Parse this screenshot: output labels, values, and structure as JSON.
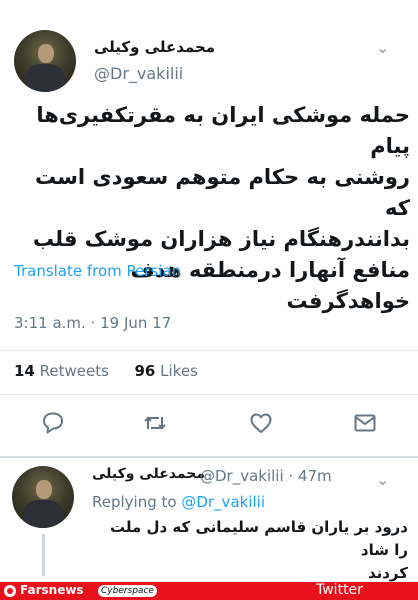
{
  "main_tweet": {
    "display_name": "محمدعلی وکیلی",
    "handle": "@Dr_vakilii",
    "text_lines": [
      "حمله موشکی ایران به مقرتکفیری‌ها پیام",
      "روشنی به حکام متوهم سعودی است که",
      "بدانندرهنگام نیاز هزاران موشک قلب",
      "منافع آنهارا درمنطقه هدف خواهدگرفت"
    ],
    "translate_label": "Translate from Persian",
    "timestamp": "3:11 a.m. · 19 Jun 17",
    "retweets_count": "14",
    "retweets_label": "Retweets",
    "likes_count": "96",
    "likes_label": "Likes",
    "menu_icon": "chevron-down-icon"
  },
  "actions": [
    {
      "name": "reply-icon"
    },
    {
      "name": "retweet-icon"
    },
    {
      "name": "like-icon"
    },
    {
      "name": "share-icon"
    }
  ],
  "reply_tweet": {
    "display_name": "محمدعلی وکیلی",
    "handle_time": "@Dr_vakilii · 47m",
    "replying_prefix": "Replying to ",
    "replying_handle": "@Dr_vakilii",
    "text_lines": [
      "درود بر یاران قاسم سلیمانی که دل ملت را شاد",
      "کردند"
    ]
  },
  "brand_bar": {
    "site": "Farsnews",
    "tag": "Cyberspace",
    "source": "Twitter",
    "color": "#e8101a"
  },
  "colors": {
    "link": "#1da1f2",
    "secondary_text": "#657786"
  }
}
